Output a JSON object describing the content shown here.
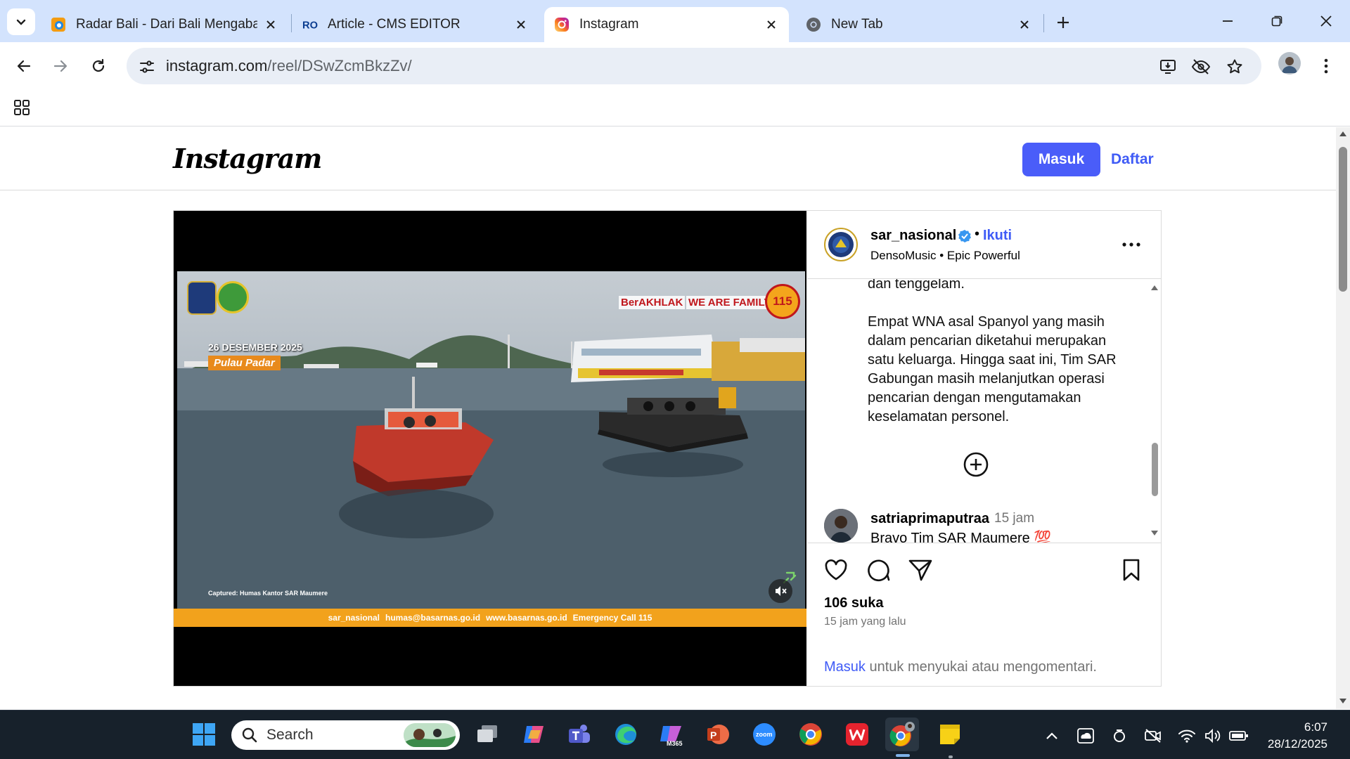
{
  "browser": {
    "tabs": [
      {
        "title": "Radar Bali - Dari Bali Mengabar",
        "icon": "radar-bali-favicon",
        "active": false
      },
      {
        "title": "Article - CMS EDITOR",
        "icon": "cms-favicon",
        "active": false
      },
      {
        "title": "Instagram",
        "icon": "instagram-favicon",
        "active": true
      },
      {
        "title": "New Tab",
        "icon": "chrome-favicon",
        "active": false
      }
    ],
    "url_host": "instagram.com",
    "url_path": "/reel/DSwZcmBkzZv/"
  },
  "instagram": {
    "logo": "Instagram",
    "login_label": "Masuk",
    "signup_label": "Daftar",
    "brand_blue": "#4a5df9"
  },
  "post": {
    "author": "sar_nasional",
    "verified": true,
    "follow_label": "Ikuti",
    "music": "DensoMusic • Epic Powerful",
    "caption_lines": [
      "dan tenggelam.",
      "",
      "Empat WNA asal Spanyol yang masih",
      "dalam pencarian diketahui merupakan",
      "satu keluarga. Hingga saat ini, Tim SAR",
      "Gabungan masih melanjutkan operasi",
      "pencarian dengan mengutamakan",
      "keselamatan personel."
    ],
    "comment": {
      "user": "satriaprimaputraa",
      "time": "15 jam",
      "text": "Bravo Tim SAR Maumere 💯"
    },
    "likes": "106 suka",
    "posted": "15 jam yang lalu",
    "login_link": "Masuk",
    "login_hint": " untuk menyukai atau mengomentari."
  },
  "video": {
    "date": "26 DESEMBER 2025",
    "place": "Pulau Padar",
    "berakhlak": "BerAKHLAK",
    "family": "WE ARE FAMILY",
    "emergency_badge": "115",
    "captured": "Captured: Humas Kantor SAR Maumere",
    "footer": [
      "sar_nasional",
      "humas@basarnas.go.id",
      "www.basarnas.go.id",
      "Emergency Call 115"
    ]
  },
  "taskbar": {
    "search_label": "Search",
    "time": "6:07",
    "date": "28/12/2025",
    "m365_label": "M365",
    "zoom_label": "zoom"
  }
}
